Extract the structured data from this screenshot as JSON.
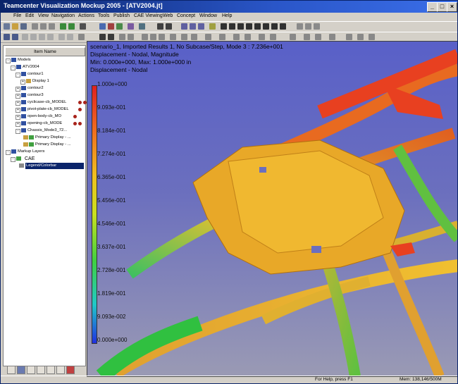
{
  "window": {
    "title": "Teamcenter Visualization Mockup 2005 - [ATV2004.jt]"
  },
  "menu": [
    "File",
    "Edit",
    "View",
    "Navigation",
    "Actions",
    "Tools",
    "Publish",
    "CAE Viewing",
    "Web",
    "Concept",
    "Window",
    "Help"
  ],
  "panel": {
    "header": "Item Name",
    "rows": [
      {
        "label": "Models"
      },
      {
        "label": "ATV2004"
      },
      {
        "label": "contour1"
      },
      {
        "label": "Display 1"
      },
      {
        "label": "contour2"
      },
      {
        "label": "contour3"
      },
      {
        "label": "cyclicase-cb_MODEL"
      },
      {
        "label": "pivot-plate-cb_MODEL"
      },
      {
        "label": "open-body-cb_MO"
      },
      {
        "label": "opening-cb_MODE"
      },
      {
        "label": "Chassis_Mode3_72..."
      },
      {
        "label": "Primary Display - ..."
      },
      {
        "label": "Primary Display - ..."
      },
      {
        "label": "Markup Layers"
      },
      {
        "label": "CAE"
      },
      {
        "label": "Legend/Colorbar"
      }
    ]
  },
  "viewport": {
    "header_lines": [
      "scenario_1, Imported Results 1, No Subcase/Step, Mode 3  : 7.236e+001",
      "Displacement - Nodal, Magnitude",
      "Min: 0.000e+000, Max: 1.000e+000 in",
      "Displacement - Nodal"
    ],
    "legend": [
      "1.000e+000",
      "9.093e-001",
      "8.184e-001",
      "7.274e-001",
      "6.365e-001",
      "5.456e-001",
      "4.546e-001",
      "3.637e-001",
      "2.728e-001",
      "1.819e-001",
      "9.093e-002",
      "0.000e+000"
    ]
  },
  "status": {
    "help": "For Help, press F1",
    "memory": "Mem: 138,146/500M"
  }
}
